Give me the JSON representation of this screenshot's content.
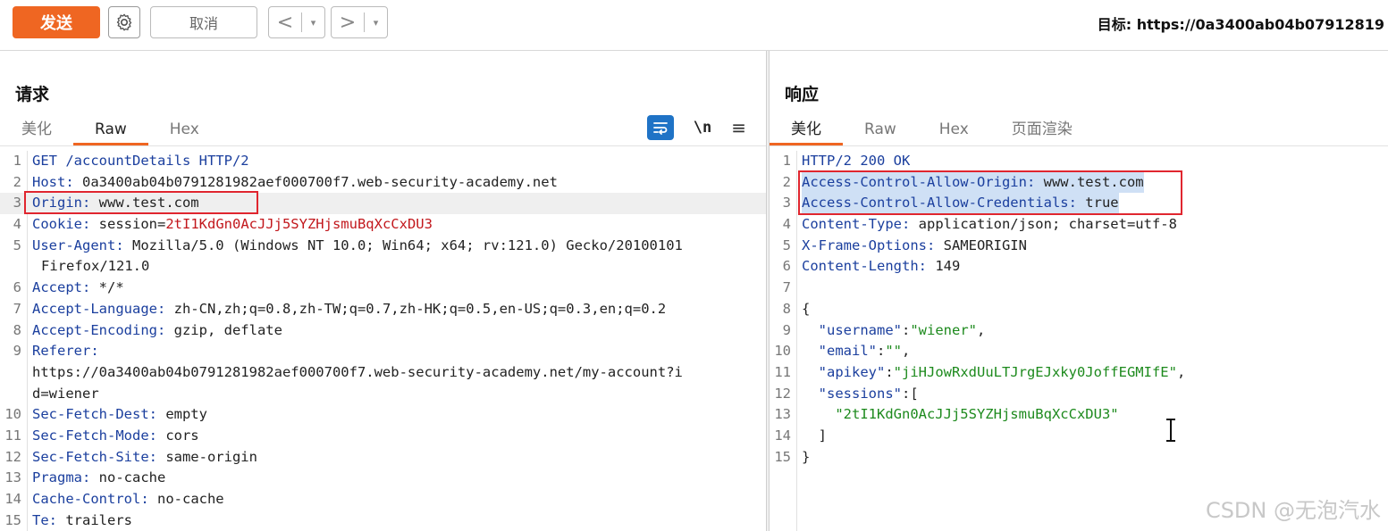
{
  "toolbar": {
    "send_label": "发送",
    "cancel_label": "取消",
    "back_arrow": "<",
    "forward_arrow": ">",
    "dropdown_glyph": "▾",
    "target_text": "目标: https://0a3400ab04b07912819"
  },
  "request": {
    "title": "请求",
    "tabs": [
      "美化",
      "Raw",
      "Hex"
    ],
    "active_tab": "Raw",
    "tools": {
      "newline_label": "\\n",
      "menu_glyph": "≡"
    }
  },
  "response": {
    "title": "响应",
    "tabs": [
      "美化",
      "Raw",
      "Hex",
      "页面渲染"
    ],
    "active_tab": "美化"
  },
  "request_lines": [
    {
      "n": "1",
      "key": "GET /accountDetails HTTP/2",
      "val": ""
    },
    {
      "n": "2",
      "key": "Host:",
      "val": " 0a3400ab04b0791281982aef000700f7.web-security-academy.net"
    },
    {
      "n": "3",
      "key": "Origin:",
      "val": " www.test.com"
    },
    {
      "n": "4",
      "key": "Cookie:",
      "val": " session=",
      "red": "2tI1KdGn0AcJJj5SYZHjsmuBqXcCxDU3"
    },
    {
      "n": "5",
      "key": "User-Agent:",
      "val": " Mozilla/5.0 (Windows NT 10.0; Win64; x64; rv:121.0) Gecko/20100101"
    },
    {
      "n": "",
      "key": "",
      "val": "Firefox/121.0",
      "cont": true
    },
    {
      "n": "6",
      "key": "Accept:",
      "val": " */*"
    },
    {
      "n": "7",
      "key": "Accept-Language:",
      "val": " zh-CN,zh;q=0.8,zh-TW;q=0.7,zh-HK;q=0.5,en-US;q=0.3,en;q=0.2"
    },
    {
      "n": "8",
      "key": "Accept-Encoding:",
      "val": " gzip, deflate"
    },
    {
      "n": "9",
      "key": "Referer:",
      "val": ""
    },
    {
      "n": "",
      "key": "",
      "val": "https://0a3400ab04b0791281982aef000700f7.web-security-academy.net/my-account?i"
    },
    {
      "n": "",
      "key": "",
      "val": "d=wiener"
    },
    {
      "n": "10",
      "key": "Sec-Fetch-Dest:",
      "val": " empty"
    },
    {
      "n": "11",
      "key": "Sec-Fetch-Mode:",
      "val": " cors"
    },
    {
      "n": "12",
      "key": "Sec-Fetch-Site:",
      "val": " same-origin"
    },
    {
      "n": "13",
      "key": "Pragma:",
      "val": " no-cache"
    },
    {
      "n": "14",
      "key": "Cache-Control:",
      "val": " no-cache"
    },
    {
      "n": "15",
      "key": "Te:",
      "val": " trailers"
    }
  ],
  "response_lines": [
    {
      "n": "1",
      "key": "HTTP/2 200 OK",
      "val": ""
    },
    {
      "n": "2",
      "key": "Access-Control-Allow-Origin:",
      "val": " www.test.com",
      "sel": true
    },
    {
      "n": "3",
      "key": "Access-Control-Allow-Credentials:",
      "val": " true",
      "sel": true
    },
    {
      "n": "4",
      "key": "Content-Type:",
      "val": " application/json; charset=utf-8"
    },
    {
      "n": "5",
      "key": "X-Frame-Options:",
      "val": " SAMEORIGIN"
    },
    {
      "n": "6",
      "key": "Content-Length:",
      "val": " 149"
    },
    {
      "n": "7",
      "key": "",
      "val": ""
    },
    {
      "n": "8",
      "key": "",
      "val": "{"
    },
    {
      "n": "9",
      "key": "  \"username\"",
      "val": ":",
      "grn": "\"wiener\"",
      "tail": ","
    },
    {
      "n": "10",
      "key": "  \"email\"",
      "val": ":",
      "grn": "\"\"",
      "tail": ","
    },
    {
      "n": "11",
      "key": "  \"apikey\"",
      "val": ":",
      "grn": "\"jiHJowRxdUuLTJrgEJxky0JoffEGMIfE\"",
      "tail": ","
    },
    {
      "n": "12",
      "key": "  \"sessions\"",
      "val": ":["
    },
    {
      "n": "13",
      "key": "",
      "val": "    ",
      "grn": "\"2tI1KdGn0AcJJj5SYZHjsmuBqXcCxDU3\""
    },
    {
      "n": "14",
      "key": "",
      "val": "  ]"
    },
    {
      "n": "15",
      "key": "",
      "val": "}"
    }
  ],
  "watermark": "CSDN @无泡汽水",
  "colors": {
    "accent": "#ef6622",
    "header_key": "#1b3f9e",
    "cookie_value": "#c2171c",
    "json_string": "#1d8a1d",
    "highlight_box": "#e0262f"
  }
}
